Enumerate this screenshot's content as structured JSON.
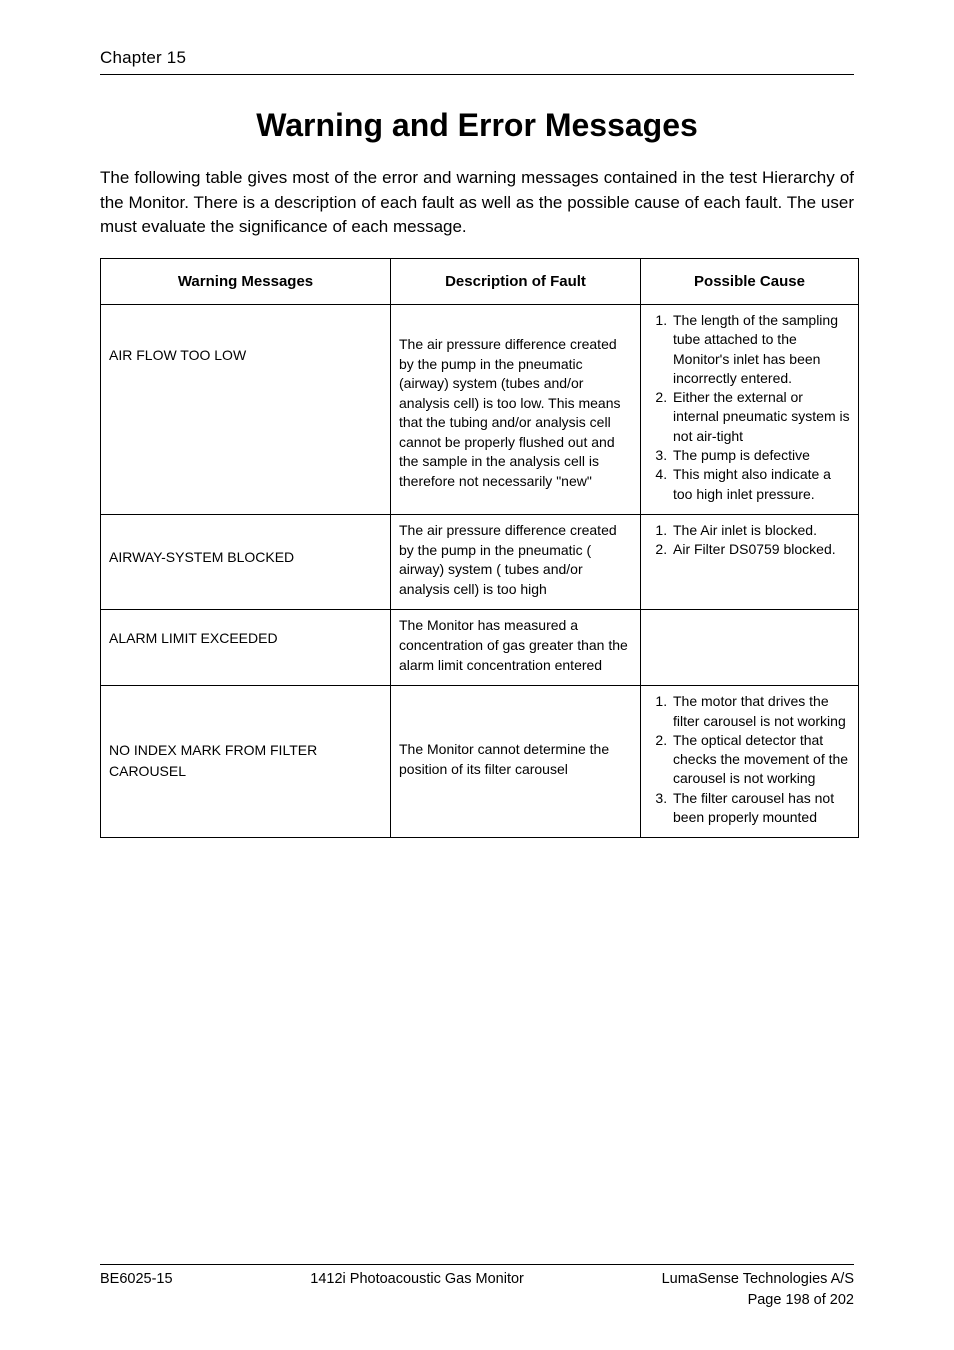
{
  "header": {
    "chapter": "Chapter 15"
  },
  "title": "Warning and Error Messages",
  "intro": "The following table gives most of the error and warning messages contained in the test Hierarchy of the Monitor. There is a description of each fault as well as the possible cause of each fault. The user must evaluate the significance of each message.",
  "table": {
    "headers": {
      "col1": "Warning Messages",
      "col2": "Description of Fault",
      "col3": "Possible Cause"
    },
    "rows": [
      {
        "name": "AIR FLOW TOO LOW",
        "desc": "The air pressure difference created by the pump in the pneumatic (airway) system (tubes and/or analysis cell) is too low. This means that the tubing and/or analysis cell cannot be properly flushed out and the sample in the analysis cell is therefore not necessarily \"new\"",
        "causes": [
          "The length of the sampling tube attached to the Monitor's inlet has been incorrectly entered.",
          "Either the external or internal pneumatic system is not air-tight",
          "The pump is defective",
          "This might also indicate a too high inlet pressure."
        ]
      },
      {
        "name": "AIRWAY-SYSTEM BLOCKED",
        "desc": "The air pressure difference created by the pump in the pneumatic ( airway) system ( tubes and/or analysis cell) is too high",
        "causes": [
          "The Air inlet is blocked.",
          "Air Filter DS0759 blocked."
        ]
      },
      {
        "name": "ALARM LIMIT EXCEEDED",
        "desc": "The Monitor has measured a concentration of gas greater than the alarm limit concentration entered",
        "causes": []
      },
      {
        "name": "NO INDEX MARK FROM FILTER CAROUSEL",
        "desc": "The Monitor cannot determine the position of its filter carousel",
        "causes": [
          "The motor that drives the filter carousel is not working",
          "The optical detector that checks the movement of the carousel is not working",
          "The filter carousel has not been properly mounted"
        ]
      }
    ]
  },
  "footer": {
    "left": "BE6025-15",
    "center": "1412i Photoacoustic Gas Monitor",
    "right1": "LumaSense Technologies A/S",
    "right2": "Page 198 of 202"
  }
}
